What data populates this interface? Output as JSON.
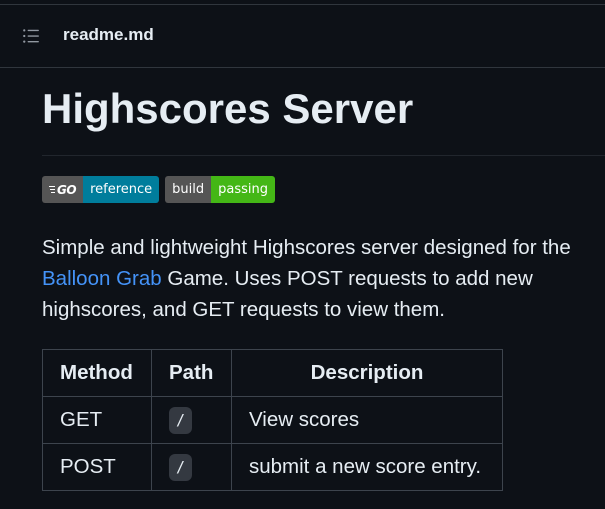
{
  "header": {
    "file_name": "readme.md",
    "toc_icon": "list-unordered-icon"
  },
  "readme": {
    "title": "Highscores Server",
    "badges": [
      {
        "left": "GO",
        "left_icon": "go-logo-icon",
        "right": "reference",
        "right_color": "#007d9c"
      },
      {
        "left": "build",
        "right": "passing",
        "right_color": "#44b716"
      }
    ],
    "description": {
      "before": "Simple and lightweight Highscores server designed for the ",
      "link": "Balloon Grab",
      "after": " Game. Uses POST requests to add new highscores, and GET requests to view them."
    },
    "table": {
      "headers": [
        "Method",
        "Path",
        "Description"
      ],
      "rows": [
        {
          "method": "GET",
          "path": "/",
          "description": "View scores"
        },
        {
          "method": "POST",
          "path": "/",
          "description": "submit a new score entry."
        }
      ]
    }
  },
  "colors": {
    "background": "#0d1117",
    "text": "#e6edf3",
    "link": "#4493f8",
    "border": "#30363d"
  }
}
